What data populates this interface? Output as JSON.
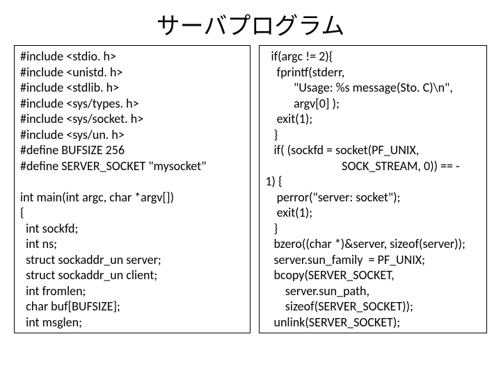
{
  "title": "サーバプログラム",
  "code_left": "#include <stdio. h>\n#include <unistd. h>\n#include <stdlib. h>\n#include <sys/types. h>\n#include <sys/socket. h>\n#include <sys/un. h>\n#define BUFSIZE 256\n#define SERVER_SOCKET \"mysocket\"\n\nint main(int argc, char *argv[])\n{\n  int sockfd;\n  int ns;\n  struct sockaddr_un server;\n  struct sockaddr_un client;\n  int fromlen;\n  char buf[BUFSIZE];\n  int msglen;",
  "code_right": "  if(argc != 2){\n    fprintf(stderr,\n          \"Usage: %s message(Sto. C)\\n\",\n          argv[0] );\n    exit(1);\n   }\n   if( (sockfd = socket(PF_UNIX,\n                           SOCK_STREAM, 0)) == -\n1) {\n    perror(\"server: socket\");\n    exit(1);\n   }\n   bzero((char *)&server, sizeof(server));\n   server.sun_family  = PF_UNIX;\n   bcopy(SERVER_SOCKET,\n       server.sun_path,\n       sizeof(SERVER_SOCKET));\n   unlink(SERVER_SOCKET);"
}
